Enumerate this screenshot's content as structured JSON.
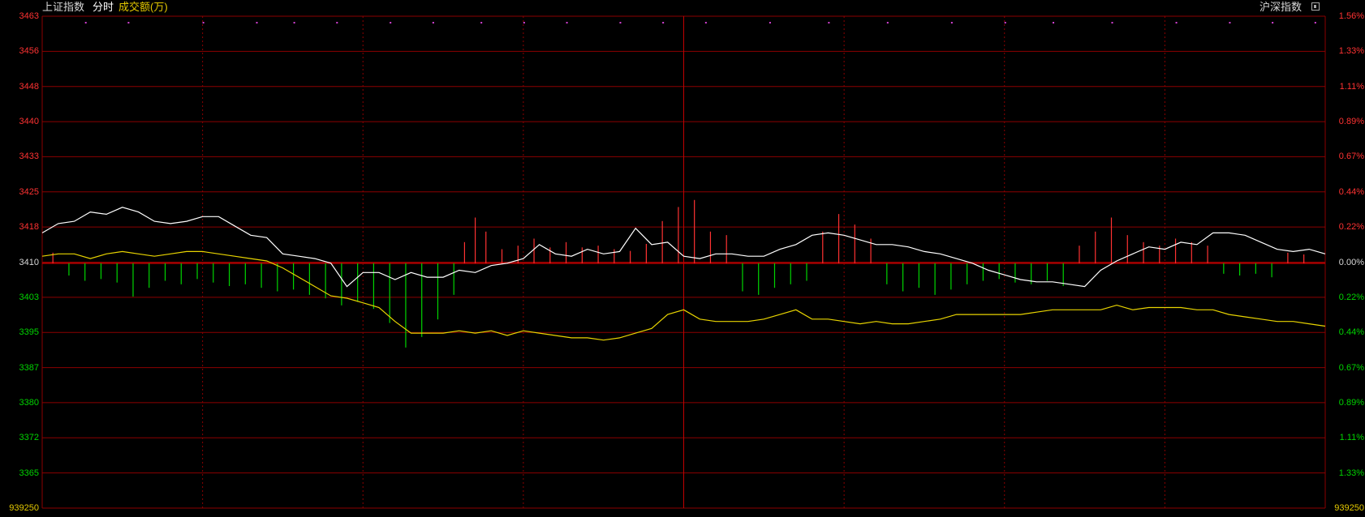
{
  "header": {
    "index_name": "上证指数",
    "mode_label": "分时",
    "volume_label": "成交额(万)",
    "right_title": "沪深指数"
  },
  "colors": {
    "background": "#000000",
    "grid": "#8c0000",
    "up": "#ff3232",
    "down": "#00d400",
    "flat": "#d8d8d8",
    "price_line": "#ffffff",
    "avg_line": "#e8d400",
    "volume_label": "#e3c800"
  },
  "chart_data": {
    "type": "line",
    "title": "",
    "base_price": 3410,
    "ylim": [
      3360,
      3463
    ],
    "y_ticks_left": [
      "3463",
      "3456",
      "3448",
      "3440",
      "3433",
      "3425",
      "3418",
      "3410",
      "3403",
      "3395",
      "3387",
      "3380",
      "3372",
      "3365"
    ],
    "y_ticks_right": [
      "1.56%",
      "1.33%",
      "1.11%",
      "0.89%",
      "0.67%",
      "0.44%",
      "0.22%",
      "0.00%",
      "0.22%",
      "0.44%",
      "0.67%",
      "0.89%",
      "1.11%",
      "1.33%"
    ],
    "volume_tick": "939250",
    "series": [
      {
        "key": "price",
        "x": [
          0,
          3,
          6,
          9,
          12,
          15,
          18,
          21,
          24,
          27,
          30,
          33,
          36,
          39,
          42,
          45,
          48,
          51,
          54,
          57,
          60,
          63,
          66,
          69,
          72,
          75,
          78,
          81,
          84,
          87,
          90,
          93,
          96,
          99,
          102,
          105,
          108,
          111,
          114,
          117,
          120,
          123,
          126,
          129,
          132,
          135,
          138,
          141,
          144,
          147,
          150,
          153,
          156,
          159,
          162,
          165,
          168,
          171,
          174,
          177,
          180,
          183,
          186,
          189,
          192,
          195,
          198,
          201,
          204,
          207,
          210,
          213,
          216,
          219,
          222,
          225,
          228,
          231,
          234,
          237,
          240
        ],
        "y": [
          3416.5,
          3418.5,
          3419,
          3421,
          3420.5,
          3422,
          3421,
          3419,
          3418.5,
          3419,
          3420,
          3420,
          3418,
          3416,
          3415.5,
          3412,
          3411.5,
          3411,
          3410,
          3405,
          3408,
          3408,
          3406.5,
          3408,
          3407,
          3407,
          3408.5,
          3408,
          3409.5,
          3410,
          3411,
          3414,
          3412,
          3411.5,
          3413,
          3412,
          3412.5,
          3417.5,
          3414,
          3414.5,
          3411.5,
          3411,
          3412,
          3412,
          3411.5,
          3411.5,
          3413,
          3414,
          3416,
          3416.5,
          3416,
          3415,
          3414,
          3414,
          3413.5,
          3412.5,
          3412,
          3411,
          3410,
          3408.5,
          3407.5,
          3406.5,
          3406,
          3406,
          3405.5,
          3405,
          3408.5,
          3410.5,
          3412,
          3413.5,
          3413,
          3414.5,
          3414,
          3416.5,
          3416.5,
          3416,
          3414.5,
          3413,
          3412.5,
          3413,
          3412
        ]
      },
      {
        "key": "average",
        "x": [
          0,
          3,
          6,
          9,
          12,
          15,
          18,
          21,
          24,
          27,
          30,
          33,
          36,
          39,
          42,
          45,
          48,
          51,
          54,
          57,
          60,
          63,
          66,
          69,
          72,
          75,
          78,
          81,
          84,
          87,
          90,
          93,
          96,
          99,
          102,
          105,
          108,
          111,
          114,
          117,
          120,
          123,
          126,
          129,
          132,
          135,
          138,
          141,
          144,
          147,
          150,
          153,
          156,
          159,
          162,
          165,
          168,
          171,
          174,
          177,
          180,
          183,
          186,
          189,
          192,
          195,
          198,
          201,
          204,
          207,
          210,
          213,
          216,
          219,
          222,
          225,
          228,
          231,
          234,
          237,
          240
        ],
        "y": [
          3411.5,
          3412,
          3412,
          3411,
          3412,
          3412.5,
          3412,
          3411.5,
          3412,
          3412.5,
          3412.5,
          3412,
          3411.5,
          3411,
          3410.5,
          3409,
          3407,
          3405,
          3403,
          3402.5,
          3401.5,
          3400.5,
          3397.5,
          3395,
          3395,
          3395,
          3395.5,
          3395,
          3395.5,
          3394.5,
          3395.5,
          3395,
          3394.5,
          3394,
          3394,
          3393.5,
          3394,
          3395,
          3396,
          3399,
          3400,
          3398,
          3397.5,
          3397.5,
          3397.5,
          3398,
          3399,
          3400,
          3398,
          3398,
          3397.5,
          3397,
          3397.5,
          3397,
          3397,
          3397.5,
          3398,
          3399,
          3399,
          3399,
          3399,
          3399,
          3399.5,
          3400,
          3400,
          3400,
          3400,
          3401,
          3400,
          3400.5,
          3400.5,
          3400.5,
          3400,
          3400,
          3399,
          3398.5,
          3398,
          3397.5,
          3397.5,
          3397,
          3396.5
        ]
      }
    ],
    "volume_bars": [
      {
        "x": 2,
        "v": 0.3
      },
      {
        "x": 5,
        "v": -0.35
      },
      {
        "x": 8,
        "v": -0.5
      },
      {
        "x": 11,
        "v": -0.45
      },
      {
        "x": 14,
        "v": -0.55
      },
      {
        "x": 17,
        "v": -0.95
      },
      {
        "x": 20,
        "v": -0.7
      },
      {
        "x": 23,
        "v": -0.5
      },
      {
        "x": 26,
        "v": -0.6
      },
      {
        "x": 29,
        "v": -0.45
      },
      {
        "x": 32,
        "v": -0.55
      },
      {
        "x": 35,
        "v": -0.65
      },
      {
        "x": 38,
        "v": -0.6
      },
      {
        "x": 41,
        "v": -0.7
      },
      {
        "x": 44,
        "v": -0.8
      },
      {
        "x": 47,
        "v": -0.75
      },
      {
        "x": 50,
        "v": -0.9
      },
      {
        "x": 53,
        "v": -1.0
      },
      {
        "x": 56,
        "v": -1.2
      },
      {
        "x": 59,
        "v": -1.1
      },
      {
        "x": 62,
        "v": -1.3
      },
      {
        "x": 65,
        "v": -1.7
      },
      {
        "x": 68,
        "v": -2.4
      },
      {
        "x": 71,
        "v": -2.1
      },
      {
        "x": 74,
        "v": -1.6
      },
      {
        "x": 77,
        "v": -0.9
      },
      {
        "x": 79,
        "v": 0.6
      },
      {
        "x": 81,
        "v": 1.3
      },
      {
        "x": 83,
        "v": 0.9
      },
      {
        "x": 86,
        "v": 0.4
      },
      {
        "x": 89,
        "v": 0.5
      },
      {
        "x": 92,
        "v": 0.7
      },
      {
        "x": 95,
        "v": 0.45
      },
      {
        "x": 98,
        "v": 0.6
      },
      {
        "x": 101,
        "v": 0.45
      },
      {
        "x": 104,
        "v": 0.5
      },
      {
        "x": 107,
        "v": 0.4
      },
      {
        "x": 110,
        "v": 0.35
      },
      {
        "x": 113,
        "v": 0.55
      },
      {
        "x": 116,
        "v": 1.2
      },
      {
        "x": 119,
        "v": 1.6
      },
      {
        "x": 122,
        "v": 1.8
      },
      {
        "x": 125,
        "v": 0.9
      },
      {
        "x": 128,
        "v": 0.8
      },
      {
        "x": 131,
        "v": -0.8
      },
      {
        "x": 134,
        "v": -0.9
      },
      {
        "x": 137,
        "v": -0.7
      },
      {
        "x": 140,
        "v": -0.6
      },
      {
        "x": 143,
        "v": -0.5
      },
      {
        "x": 146,
        "v": 0.9
      },
      {
        "x": 149,
        "v": 1.4
      },
      {
        "x": 152,
        "v": 1.1
      },
      {
        "x": 155,
        "v": 0.7
      },
      {
        "x": 158,
        "v": -0.6
      },
      {
        "x": 161,
        "v": -0.8
      },
      {
        "x": 164,
        "v": -0.7
      },
      {
        "x": 167,
        "v": -0.9
      },
      {
        "x": 170,
        "v": -0.75
      },
      {
        "x": 173,
        "v": -0.6
      },
      {
        "x": 176,
        "v": -0.5
      },
      {
        "x": 179,
        "v": -0.45
      },
      {
        "x": 182,
        "v": -0.55
      },
      {
        "x": 185,
        "v": -0.6
      },
      {
        "x": 188,
        "v": -0.5
      },
      {
        "x": 191,
        "v": -0.65
      },
      {
        "x": 194,
        "v": 0.5
      },
      {
        "x": 197,
        "v": 0.9
      },
      {
        "x": 200,
        "v": 1.3
      },
      {
        "x": 203,
        "v": 0.8
      },
      {
        "x": 206,
        "v": 0.6
      },
      {
        "x": 209,
        "v": 0.5
      },
      {
        "x": 212,
        "v": 0.7
      },
      {
        "x": 215,
        "v": 0.6
      },
      {
        "x": 218,
        "v": 0.5
      },
      {
        "x": 221,
        "v": -0.3
      },
      {
        "x": 224,
        "v": -0.35
      },
      {
        "x": 227,
        "v": -0.3
      },
      {
        "x": 230,
        "v": -0.4
      },
      {
        "x": 233,
        "v": 0.3
      },
      {
        "x": 236,
        "v": 0.25
      }
    ],
    "markers": [
      8,
      16,
      30,
      40,
      47,
      55,
      65,
      73,
      82,
      90,
      98,
      108,
      116,
      124,
      136,
      147,
      158,
      170,
      180,
      189,
      200,
      212,
      222,
      230,
      238
    ]
  }
}
